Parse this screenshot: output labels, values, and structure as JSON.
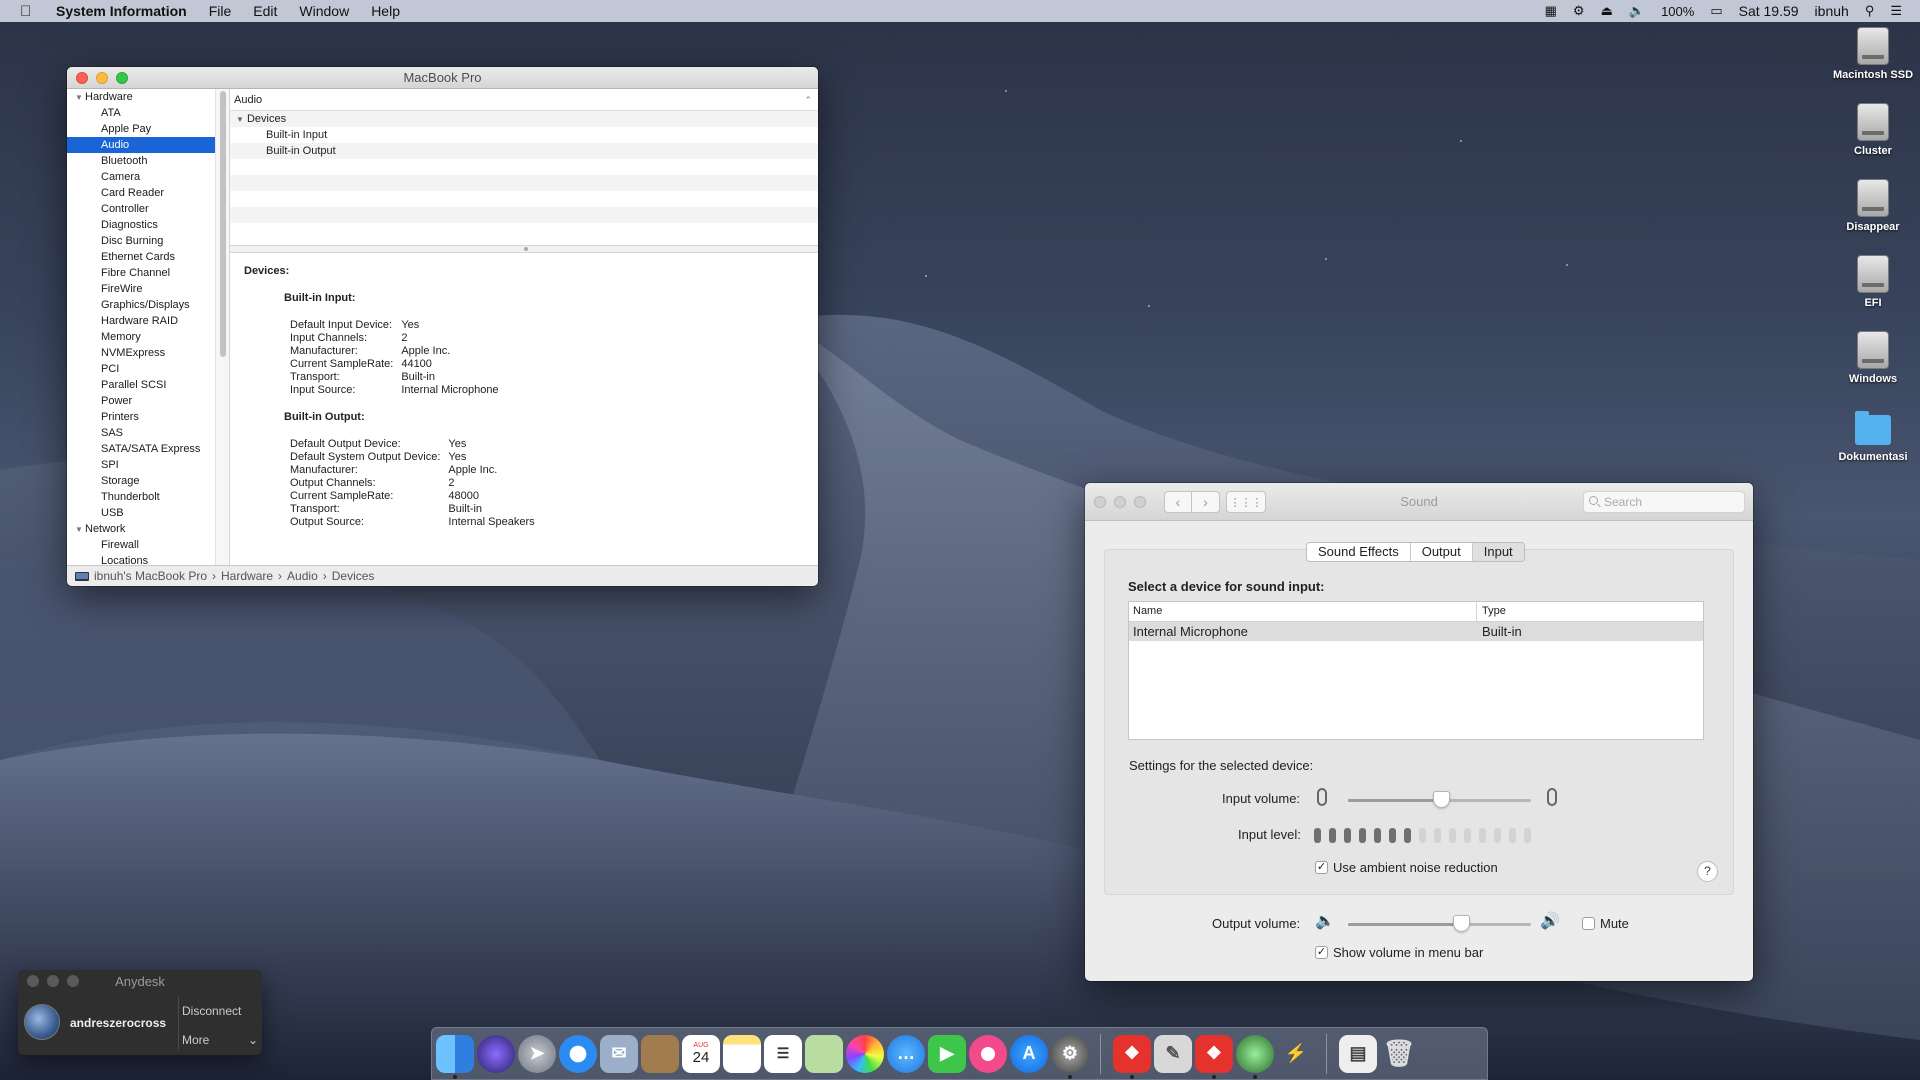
{
  "menubar": {
    "app": "System Information",
    "menus": [
      "File",
      "Edit",
      "Window",
      "Help"
    ],
    "battery": "100%",
    "clock": "Sat 19.59",
    "user": "ibnuh"
  },
  "sysinfo": {
    "title": "MacBook Pro",
    "sidebar": {
      "hardware_label": "Hardware",
      "hardware_items": [
        "ATA",
        "Apple Pay",
        "Audio",
        "Bluetooth",
        "Camera",
        "Card Reader",
        "Controller",
        "Diagnostics",
        "Disc Burning",
        "Ethernet Cards",
        "Fibre Channel",
        "FireWire",
        "Graphics/Displays",
        "Hardware RAID",
        "Memory",
        "NVMExpress",
        "PCI",
        "Parallel SCSI",
        "Power",
        "Printers",
        "SAS",
        "SATA/SATA Express",
        "SPI",
        "Storage",
        "Thunderbolt",
        "USB"
      ],
      "selected": "Audio",
      "network_label": "Network",
      "network_items": [
        "Firewall",
        "Locations"
      ]
    },
    "table_header": "Audio",
    "tree": {
      "group": "Devices",
      "items": [
        "Built-in Input",
        "Built-in Output"
      ]
    },
    "detail": {
      "heading": "Devices:",
      "input_title": "Built-in Input:",
      "input_keys": [
        "Default Input Device:",
        "Input Channels:",
        "Manufacturer:",
        "Current SampleRate:",
        "Transport:",
        "Input Source:"
      ],
      "input_values": [
        "Yes",
        "2",
        "Apple Inc.",
        "44100",
        "Built-in",
        "Internal Microphone"
      ],
      "output_title": "Built-in Output:",
      "output_keys": [
        "Default Output Device:",
        "Default System Output Device:",
        "Manufacturer:",
        "Output Channels:",
        "Current SampleRate:",
        "Transport:",
        "Output Source:"
      ],
      "output_values": [
        "Yes",
        "Yes",
        "Apple Inc.",
        "2",
        "48000",
        "Built-in",
        "Internal Speakers"
      ]
    },
    "path": [
      "ibnuh's MacBook Pro",
      "Hardware",
      "Audio",
      "Devices"
    ]
  },
  "sound": {
    "title": "Sound",
    "search_placeholder": "Search",
    "tabs": [
      "Sound Effects",
      "Output",
      "Input"
    ],
    "active_tab": "Input",
    "select_label": "Select a device for sound input:",
    "columns": [
      "Name",
      "Type"
    ],
    "devices": [
      {
        "name": "Internal Microphone",
        "type": "Built-in"
      }
    ],
    "settings_label": "Settings for the selected device:",
    "input_volume_label": "Input volume:",
    "input_volume_value": 0.51,
    "input_level_label": "Input level:",
    "input_level_active": 7,
    "input_level_total": 15,
    "ambient_label": "Use ambient noise reduction",
    "ambient_checked": true,
    "help": "?",
    "output_volume_label": "Output volume:",
    "output_volume_value": 0.62,
    "mute_label": "Mute",
    "mute_checked": false,
    "show_volume_label": "Show volume in menu bar",
    "show_volume_checked": true
  },
  "desktop_icons": [
    "Macintosh SSD",
    "Cluster",
    "Disappear",
    "EFI",
    "Windows",
    "Dokumentasi"
  ],
  "anydesk": {
    "title": "Anydesk",
    "user": "andreszerocross",
    "disconnect": "Disconnect",
    "more": "More"
  },
  "dock": {
    "calendar_month": "AUG",
    "calendar_day": "24"
  },
  "colors": {
    "selection_blue": "#1b64d8",
    "close": "#fc605b",
    "minimize": "#fdbc40",
    "zoom": "#34c84a"
  }
}
